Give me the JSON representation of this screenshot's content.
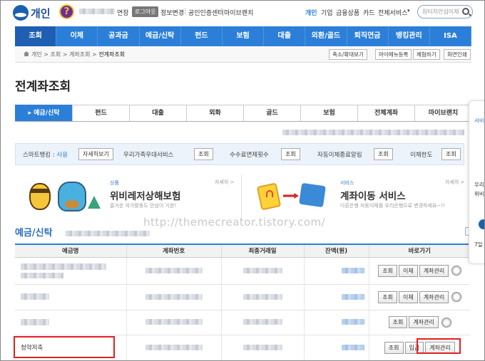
{
  "header": {
    "brand": "개인",
    "help_glyph": "?",
    "extend_label": "연장",
    "logout_label": "로그아웃",
    "links": [
      "정보변경",
      "공인인증센터",
      "마이브랜치"
    ],
    "segments": [
      "개인",
      "기업",
      "금융상품",
      "카드",
      "전체서비스"
    ],
    "search_placeholder": "원터치안심이체"
  },
  "nav": [
    "조회",
    "이체",
    "공과금",
    "예금/신탁",
    "펀드",
    "보험",
    "대출",
    "외환/골드",
    "퇴직연금",
    "뱅킹관리",
    "ISA"
  ],
  "breadcrumb": {
    "items": [
      "개인",
      "조회",
      "계좌조회"
    ],
    "current": "전계좌조회",
    "buttons": [
      "축소/확대보기",
      "마이메뉴등록",
      "체험하기",
      "화면인쇄"
    ]
  },
  "page_title": "전계좌조회",
  "tabs": [
    "예금/신탁",
    "펀드",
    "대출",
    "외화",
    "골드",
    "보험",
    "전체계좌",
    "마이브랜치"
  ],
  "info_bar": {
    "smart_label": "스마트뱅킹 :",
    "smart_value": "사용",
    "smart_button": "자세히보기",
    "items": [
      {
        "label": "우리가족우대서비스",
        "button": "조회"
      },
      {
        "label": "수수료면제횟수",
        "button": "조회"
      },
      {
        "label": "자동이체종료알림",
        "button": "조회"
      },
      {
        "label": "이체한도",
        "button": "조회"
      }
    ]
  },
  "banners": [
    {
      "category": "상품",
      "title": "위비레저상해보험",
      "subtitle": "즐거운 여가활동도 안심이 기본!",
      "more": "자세히 >"
    },
    {
      "category": "서비스",
      "title": "계좌이동 서비스",
      "subtitle": "다른은행 자동이체를 우리은행으로 변경하세요~!!",
      "more": "자세히 >"
    }
  ],
  "watermark": "http://themecreator.tistory.com/",
  "section_title": "예금/신탁",
  "table": {
    "headers": [
      "예금명",
      "계좌번호",
      "최종거래일",
      "잔액(원)",
      "바로가기"
    ],
    "rows": [
      {
        "name": "",
        "buttons": [
          "조회",
          "이체",
          "계좌관리"
        ],
        "icon": true
      },
      {
        "name": "",
        "buttons": [
          "조회",
          "이체",
          "계좌관리"
        ],
        "icon": true
      },
      {
        "name": "",
        "buttons": [
          "조회",
          "계좌관리"
        ],
        "icon": true
      },
      {
        "name": "청약저축",
        "buttons": [
          "조회",
          "입금",
          "계좌관리"
        ],
        "icon": false
      }
    ]
  },
  "side_panel": {
    "lines": [
      "서비",
      "우리",
      "위비",
      "7일"
    ]
  },
  "colors": {
    "primary": "#2c7fd8",
    "nav_active": "#1f5fb1",
    "highlight": "#e12020"
  }
}
